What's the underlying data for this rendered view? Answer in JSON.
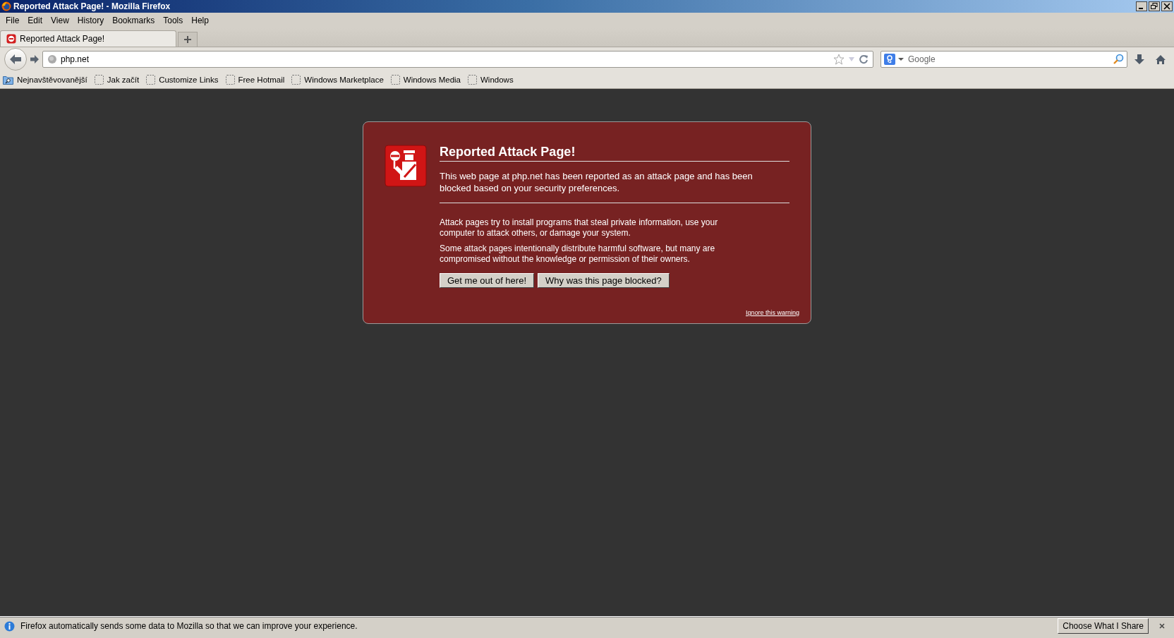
{
  "window": {
    "title": "Reported Attack Page! - Mozilla Firefox"
  },
  "menu": [
    "File",
    "Edit",
    "View",
    "History",
    "Bookmarks",
    "Tools",
    "Help"
  ],
  "tabs": [
    {
      "label": "Reported Attack Page!",
      "selected": true
    }
  ],
  "address_bar": {
    "value": "php.net"
  },
  "search": {
    "placeholder": "Google"
  },
  "bookmarks": [
    {
      "label": "Nejnavštěvovanější",
      "kind": "folder"
    },
    {
      "label": "Jak začít",
      "kind": "link"
    },
    {
      "label": "Customize Links",
      "kind": "link"
    },
    {
      "label": "Free Hotmail",
      "kind": "link"
    },
    {
      "label": "Windows Marketplace",
      "kind": "link"
    },
    {
      "label": "Windows Media",
      "kind": "link"
    },
    {
      "label": "Windows",
      "kind": "link"
    }
  ],
  "error": {
    "title": "Reported Attack Page!",
    "intro": "This web page at php.net has been reported as an attack page and has been blocked based on your security preferences.",
    "paragraphs": [
      "Attack pages try to install programs that steal private information, use your computer to attack others, or damage your system.",
      "Some attack pages intentionally distribute harmful software, but many are compromised without the knowledge or permission of their owners."
    ],
    "buttons": [
      "Get me out of here!",
      "Why was this page blocked?"
    ],
    "ignore_link": "Ignore this warning"
  },
  "notification": {
    "text": "Firefox automatically sends some data to Mozilla so that we can improve your experience.",
    "button": "Choose What I Share"
  }
}
